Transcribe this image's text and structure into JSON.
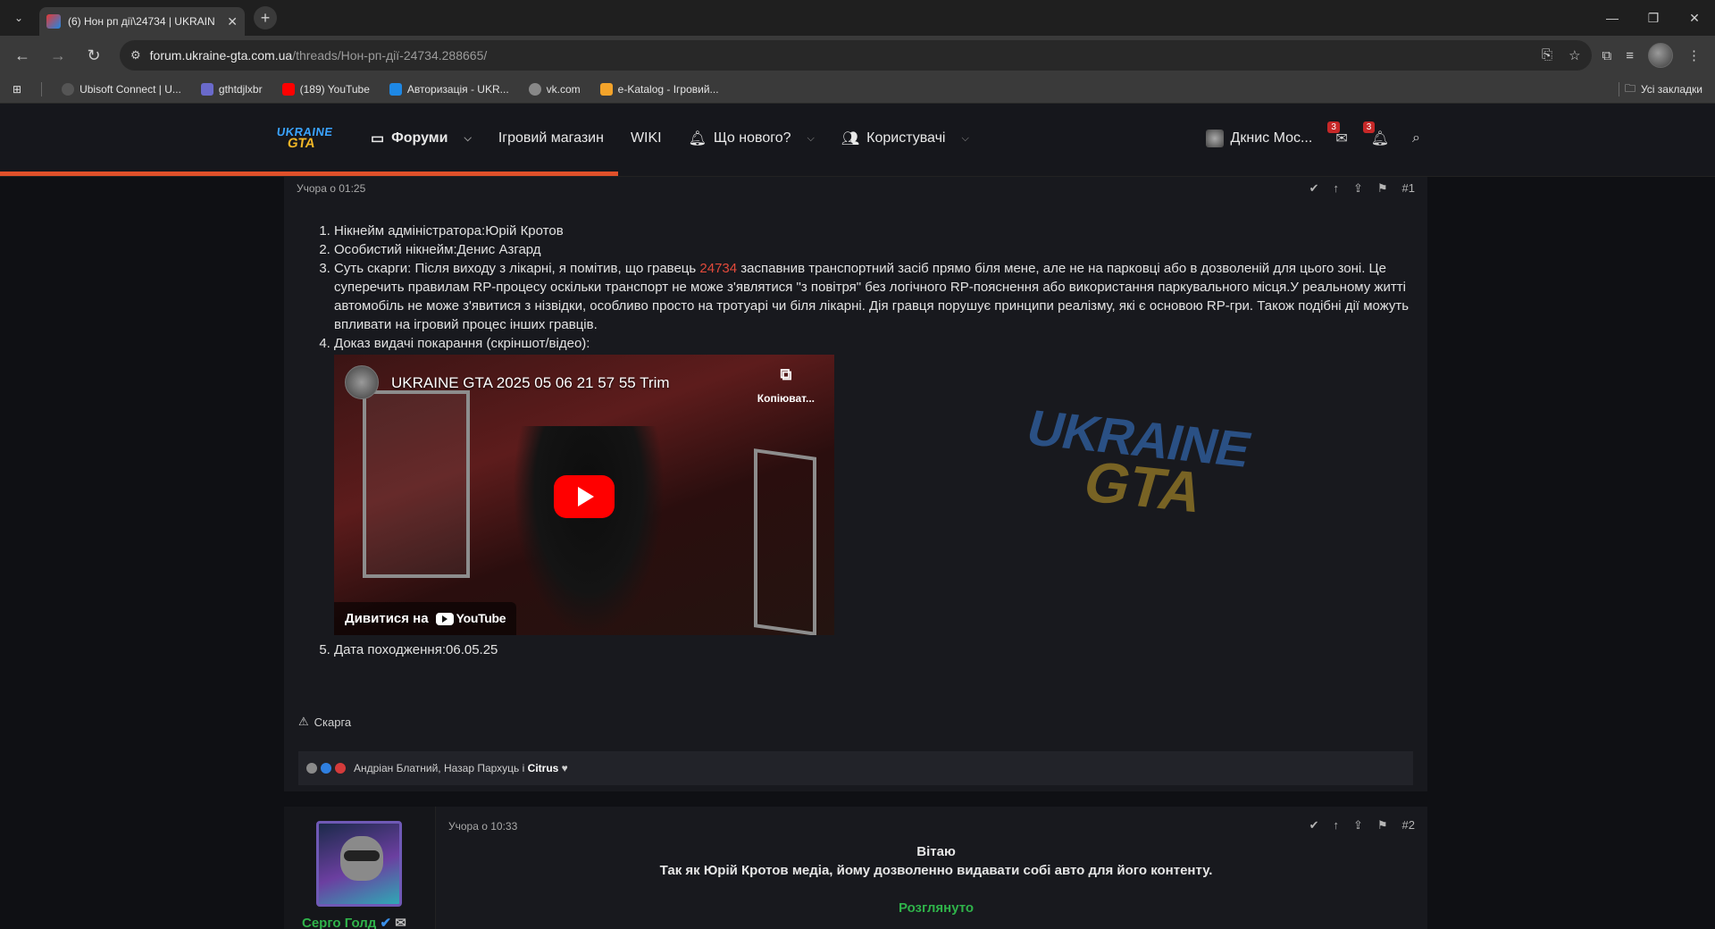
{
  "browser": {
    "tab_title": "(6) Нон рп дії\\24734 | UKRAIN",
    "url_host": "forum.ukraine-gta.com.ua",
    "url_path": "/threads/Нон-рп-дії-24734.288665/",
    "bookmarks": [
      {
        "label": "Ubisoft Connect | U...",
        "color": "#555"
      },
      {
        "label": "gthtdjlxbr",
        "color": "#6a6acb"
      },
      {
        "label": "(189) YouTube",
        "color": "#ff0000"
      },
      {
        "label": "Авторизація - UKR...",
        "color": "#1e88e5"
      },
      {
        "label": "vk.com",
        "color": "#888"
      },
      {
        "label": "e-Katalog - Ігровий...",
        "color": "#f3a32a"
      }
    ],
    "all_bookmarks": "Усі закладки"
  },
  "header": {
    "logo_top": "UKRAINE",
    "logo_bottom": "GTA",
    "nav": {
      "forums": "Форуми",
      "shop": "Ігровий магазин",
      "wiki": "WIKI",
      "whats_new": "Що нового?",
      "members": "Користувачі"
    },
    "user": "Дкнис Мос...",
    "inbox_count": "3",
    "alerts_count": "3"
  },
  "post1": {
    "time": "Учора о 01:25",
    "number": "#1",
    "items": {
      "i1": "Нікнейм адміністратора:Юрій Кротов",
      "i2": "Особистий нікнейм:Денис Азгард",
      "i3_before": "Суть скарги: Після виходу з лікарні, я помітив, що гравець ",
      "i3_user": "24734",
      "i3_after": " заспавнив транспортний засіб прямо біля мене, але не на парковці або в дозволеній для цього зоні. Це суперечить правилам RP-процесу оскільки транспорт не може з'являтися \"з повітря\" без логічного RP-пояснення або використання паркувального місця.У реальному житті автомобіль не може з'явитися з нізвідки, особливо просто на тротуарі чи біля лікарні. Дія гравця порушує принципи реалізму, які є основою RP-гри. Також подібні дії можуть впливати на ігровий процес інших гравців.",
      "i4": "Доказ видачі покарання (скріншот/відео):",
      "i5": "Дата походження:06.05.25"
    },
    "video": {
      "title": "UKRAINE GTA 2025 05 06 21 57 55 Trim",
      "copy_label": "Копіюват...",
      "watch_on": "Дивитися на",
      "youtube": "YouTube"
    },
    "report": "Скарга",
    "reactions_names": "Андріан Блатний, Назар Пархуць і ",
    "reactions_last": "Citrus",
    "reactions_heart": "♥"
  },
  "post2": {
    "time": "Учора о 10:33",
    "number": "#2",
    "author": "Серго Голд",
    "line1": "Вітаю",
    "line2": "Так як Юрій Кротов медіа, йому дозволенно видавати собі авто для його контенту.",
    "status": "Розглянуто"
  }
}
